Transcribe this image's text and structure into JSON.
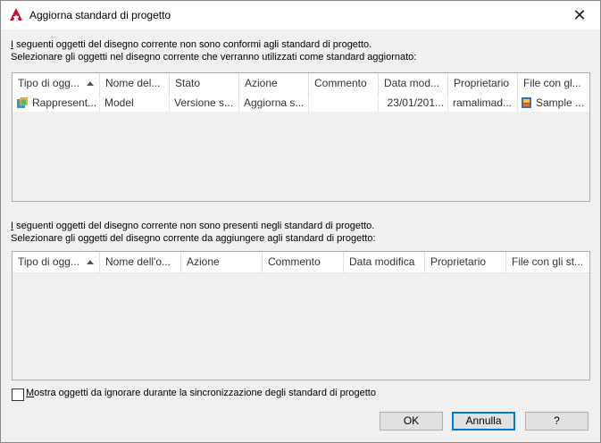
{
  "window": {
    "title": "Aggiorna standard di progetto",
    "close_glyph": "✕"
  },
  "section1": {
    "line1_prefix": "I",
    "line1_rest": " seguenti oggetti del disegno corrente non sono conformi agli standard di progetto.",
    "line2": "Selezionare gli oggetti nel disegno corrente che verranno utilizzati come standard aggiornato:",
    "columns": [
      "Tipo di ogg...",
      "Nome del...",
      "Stato",
      "Azione",
      "Commento",
      "Data mod...",
      "Proprietario",
      "File con gl..."
    ],
    "rows": [
      [
        "Rappresent...",
        "Model",
        "Versione s...",
        "Aggiorna s...",
        "",
        "23/01/201...",
        "ramalimad...",
        "Sample ..."
      ]
    ]
  },
  "section2": {
    "line1_prefix": "I",
    "line1_rest": " seguenti oggetti del disegno corrente non sono presenti negli standard di progetto.",
    "line2": "Selezionare gli oggetti del disegno corrente da aggiungere agli standard di progetto:",
    "columns": [
      "Tipo di ogg...",
      "Nome dell'o...",
      "Azione",
      "Commento",
      "Data modifica",
      "Proprietario",
      "File con gli st..."
    ]
  },
  "checkbox": {
    "label_prefix": "M",
    "label_rest": "ostra oggetti da ignorare durante la sincronizzazione degli standard di progetto",
    "checked": false
  },
  "buttons": {
    "ok": "OK",
    "cancel": "Annulla",
    "help": "?"
  },
  "colors": {
    "accent": "#0078d7",
    "app_red": "#c8102e"
  }
}
